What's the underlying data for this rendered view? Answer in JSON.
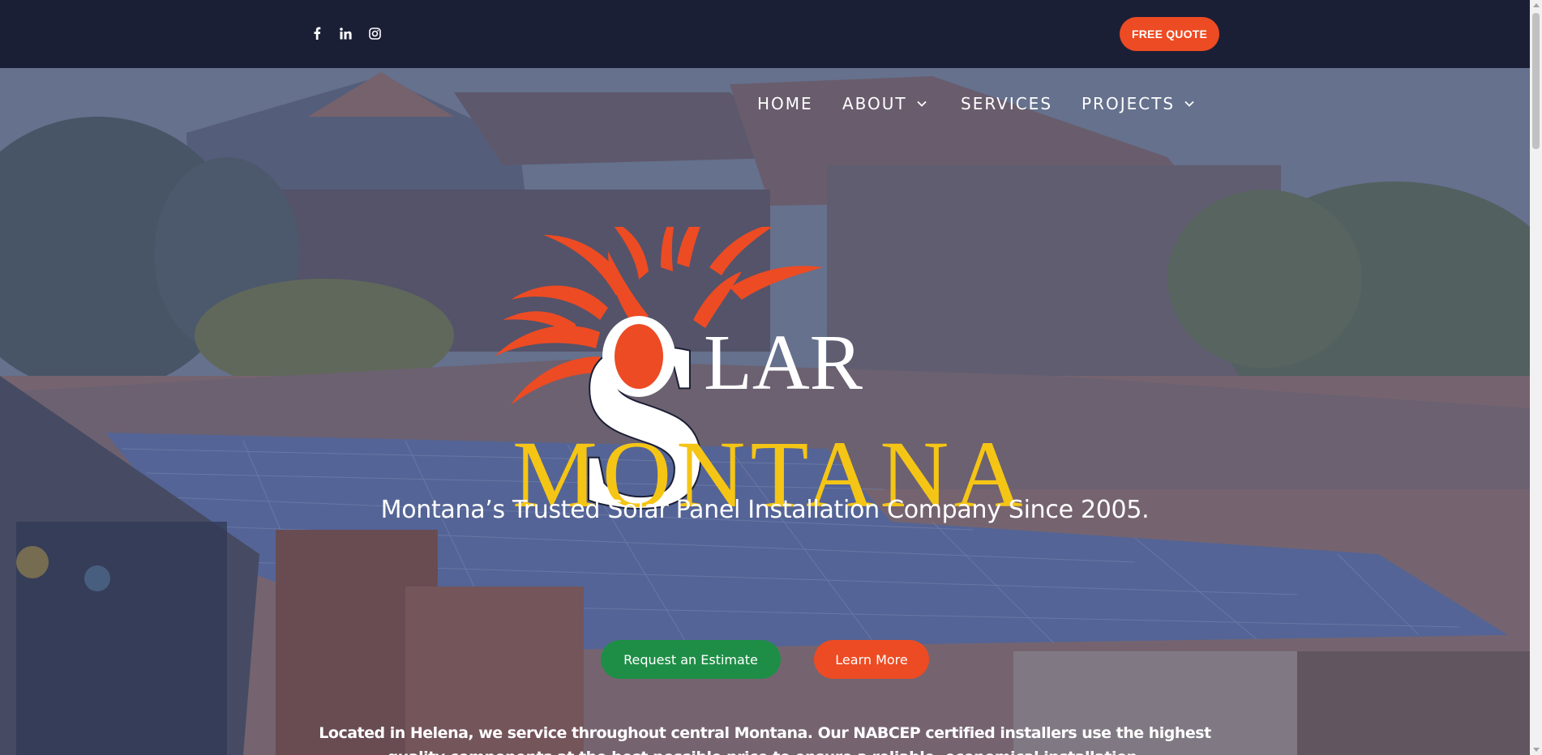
{
  "topbar": {
    "social": [
      {
        "icon": "facebook-icon"
      },
      {
        "icon": "linkedin-icon"
      },
      {
        "icon": "instagram-icon"
      }
    ],
    "quote_label": "FREE QUOTE"
  },
  "nav": {
    "items": [
      {
        "label": "HOME"
      },
      {
        "label": "ABOUT"
      },
      {
        "label": "SERVICES"
      },
      {
        "label": "PROJECTS"
      }
    ]
  },
  "logo": {
    "word1": "LAR",
    "word2": "MONTANA",
    "letter_s": "S",
    "letter_o": "O"
  },
  "hero": {
    "tagline": "Montana’s Trusted Solar Panel Installation Company Since 2005.",
    "primary_button": "Request an Estimate",
    "secondary_button": "Learn More",
    "location_text": "Located in Helena, we service throughout central Montana. Our NABCEP certified installers use the highest quality components at the best possible price to ensure a reliable, economical installation."
  },
  "colors": {
    "navy": "#1b1f36",
    "orange": "#ed4b23",
    "green": "#1e8e47",
    "gold": "#f5c515"
  }
}
